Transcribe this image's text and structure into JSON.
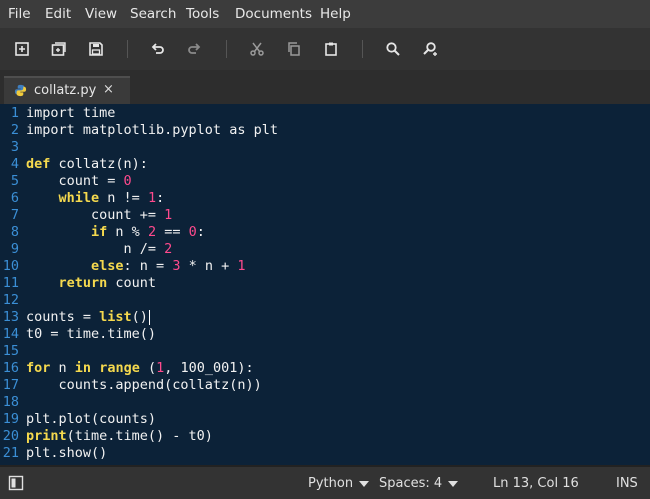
{
  "menu": [
    "File",
    "Edit",
    "View",
    "Search",
    "Tools",
    "Documents",
    "Help"
  ],
  "toolbar": {
    "icons": [
      "new-document-icon",
      "new-window-icon",
      "save-icon",
      "undo-icon",
      "redo-icon",
      "cut-icon",
      "copy-icon",
      "paste-icon",
      "search-icon",
      "replace-icon"
    ]
  },
  "tab": {
    "label": "collatz.py",
    "close": "×"
  },
  "editor": {
    "lines": [
      {
        "n": "1",
        "tokens": [
          [
            "t",
            "import time"
          ]
        ]
      },
      {
        "n": "2",
        "tokens": [
          [
            "t",
            "import matplotlib.pyplot as plt"
          ]
        ]
      },
      {
        "n": "3",
        "tokens": []
      },
      {
        "n": "4",
        "tokens": [
          [
            "k",
            "def"
          ],
          [
            "t",
            " collatz(n):"
          ]
        ]
      },
      {
        "n": "5",
        "tokens": [
          [
            "t",
            "    count = "
          ],
          [
            "d",
            "0"
          ]
        ]
      },
      {
        "n": "6",
        "tokens": [
          [
            "t",
            "    "
          ],
          [
            "k",
            "while"
          ],
          [
            "t",
            " n != "
          ],
          [
            "d",
            "1"
          ],
          [
            "t",
            ":"
          ]
        ]
      },
      {
        "n": "7",
        "tokens": [
          [
            "t",
            "        count += "
          ],
          [
            "d",
            "1"
          ]
        ]
      },
      {
        "n": "8",
        "tokens": [
          [
            "t",
            "        "
          ],
          [
            "k",
            "if"
          ],
          [
            "t",
            " n % "
          ],
          [
            "d",
            "2"
          ],
          [
            "t",
            " == "
          ],
          [
            "d",
            "0"
          ],
          [
            "t",
            ":"
          ]
        ]
      },
      {
        "n": "9",
        "tokens": [
          [
            "t",
            "            n /= "
          ],
          [
            "d",
            "2"
          ]
        ]
      },
      {
        "n": "10",
        "tokens": [
          [
            "t",
            "        "
          ],
          [
            "k",
            "else"
          ],
          [
            "t",
            ": n = "
          ],
          [
            "d",
            "3"
          ],
          [
            "t",
            " * n + "
          ],
          [
            "d",
            "1"
          ]
        ]
      },
      {
        "n": "11",
        "tokens": [
          [
            "t",
            "    "
          ],
          [
            "k",
            "return"
          ],
          [
            "t",
            " count"
          ]
        ]
      },
      {
        "n": "12",
        "tokens": []
      },
      {
        "n": "13",
        "tokens": [
          [
            "t",
            "counts = "
          ],
          [
            "k",
            "list"
          ],
          [
            "t",
            "()"
          ]
        ],
        "caret": true
      },
      {
        "n": "14",
        "tokens": [
          [
            "t",
            "t0 = time.time()"
          ]
        ]
      },
      {
        "n": "15",
        "tokens": []
      },
      {
        "n": "16",
        "tokens": [
          [
            "k",
            "for"
          ],
          [
            "t",
            " n "
          ],
          [
            "k",
            "in"
          ],
          [
            "t",
            " "
          ],
          [
            "k",
            "range"
          ],
          [
            "t",
            " ("
          ],
          [
            "d",
            "1"
          ],
          [
            "t",
            ", 100_001):"
          ]
        ]
      },
      {
        "n": "17",
        "tokens": [
          [
            "t",
            "    counts.append(collatz(n))"
          ]
        ]
      },
      {
        "n": "18",
        "tokens": []
      },
      {
        "n": "19",
        "tokens": [
          [
            "t",
            "plt.plot(counts)"
          ]
        ]
      },
      {
        "n": "20",
        "tokens": [
          [
            "k",
            "print"
          ],
          [
            "t",
            "(time.time() - t0)"
          ]
        ]
      },
      {
        "n": "21",
        "tokens": [
          [
            "t",
            "plt.show()"
          ]
        ]
      }
    ]
  },
  "status": {
    "language": "Python",
    "indent": "Spaces: 4",
    "position": "Ln 13, Col 16",
    "mode": "INS"
  },
  "colors": {
    "background": "#0c2238",
    "keyword": "#f5d94e",
    "number": "#ff4a8d",
    "line_number": "#3b8fd6"
  }
}
